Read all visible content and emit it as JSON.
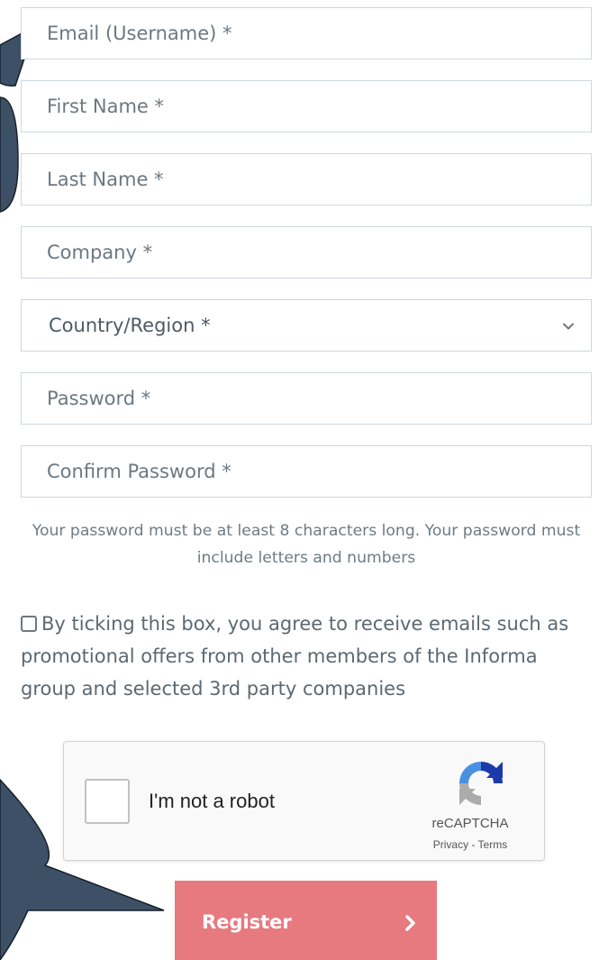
{
  "form": {
    "fields": [
      {
        "placeholder": "Email (Username) *",
        "value": ""
      },
      {
        "placeholder": "First Name *",
        "value": ""
      },
      {
        "placeholder": "Last Name *",
        "value": ""
      },
      {
        "placeholder": "Company *",
        "value": ""
      },
      {
        "placeholder": "Password *",
        "value": ""
      },
      {
        "placeholder": "Confirm Password *",
        "value": ""
      }
    ],
    "country_select": {
      "selected": "Country/Region *"
    },
    "password_help": "Your password must be at least 8 characters long. Your password must include letters and numbers",
    "consent": {
      "checked": false,
      "text": "By ticking this box, you agree to receive emails such as promotional offers from other members of the Informa group and selected 3rd party companies"
    },
    "recaptcha": {
      "label": "I'm not a robot",
      "brand": "reCAPTCHA",
      "links": "Privacy - Terms"
    },
    "register_label": "Register"
  },
  "icons": {
    "select_chevron": "chevron-down-icon",
    "register_chevron": "chevron-right-icon",
    "recaptcha_logo": "recaptcha-logo-icon"
  },
  "colors": {
    "register_button": "#e77a7f",
    "arrow_fill": "#3d5066",
    "input_border": "#cfd8de",
    "text": "#5f6b73"
  }
}
